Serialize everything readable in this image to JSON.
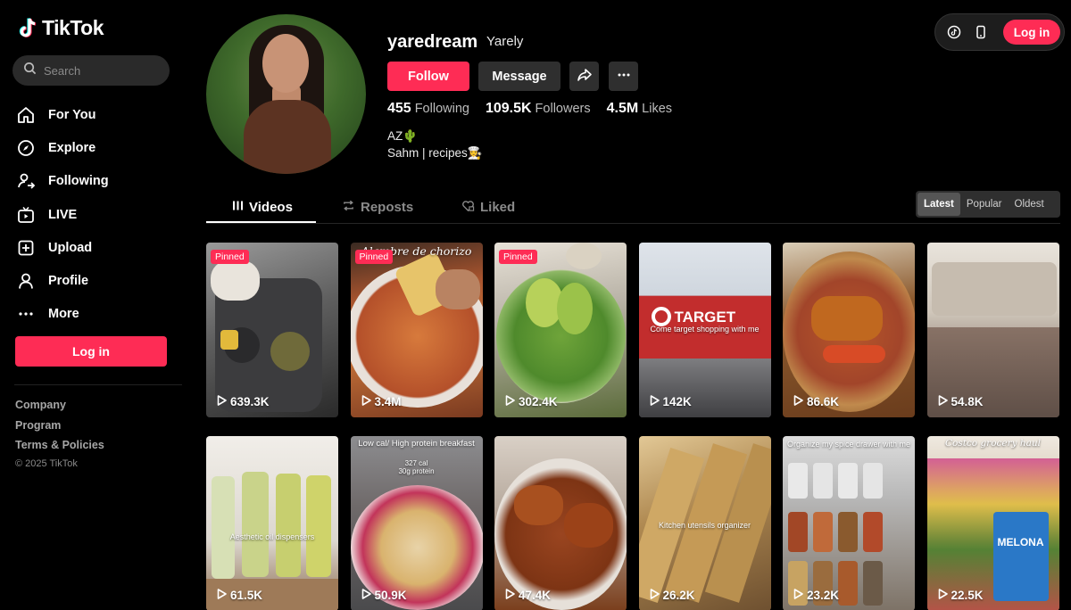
{
  "brand": {
    "name": "TikTok",
    "accent": "#fe2c55"
  },
  "search": {
    "placeholder": "Search"
  },
  "sidebar": {
    "items": [
      {
        "label": "For You",
        "icon": "home-icon"
      },
      {
        "label": "Explore",
        "icon": "compass-icon"
      },
      {
        "label": "Following",
        "icon": "following-icon"
      },
      {
        "label": "LIVE",
        "icon": "live-icon"
      },
      {
        "label": "Upload",
        "icon": "upload-icon"
      },
      {
        "label": "Profile",
        "icon": "profile-icon"
      },
      {
        "label": "More",
        "icon": "more-icon"
      }
    ],
    "login_label": "Log in",
    "footer_links": [
      "Company",
      "Program",
      "Terms & Policies"
    ],
    "copyright": "© 2025 TikTok"
  },
  "topbar": {
    "login_label": "Log in"
  },
  "profile": {
    "username": "yaredream",
    "nickname": "Yarely",
    "follow_label": "Follow",
    "message_label": "Message",
    "stats": {
      "following_count": "455",
      "following_label": "Following",
      "followers_count": "109.5K",
      "followers_label": "Followers",
      "likes_count": "4.5M",
      "likes_label": "Likes"
    },
    "bio_line1": "AZ🌵",
    "bio_line2": "Sahm | recipes👩‍🍳"
  },
  "tabs": {
    "videos": "Videos",
    "reposts": "Reposts",
    "liked": "Liked"
  },
  "sort": {
    "latest": "Latest",
    "popular": "Popular",
    "oldest": "Oldest",
    "selected": "Latest"
  },
  "videos": [
    {
      "views": "639.3K",
      "pinned": "Pinned",
      "caption": ""
    },
    {
      "views": "3.4M",
      "pinned": "Pinned",
      "caption": "Alambre de chorizo"
    },
    {
      "views": "302.4K",
      "pinned": "Pinned",
      "caption": ""
    },
    {
      "views": "142K",
      "pinned": "",
      "caption": "Come target shopping with me"
    },
    {
      "views": "86.6K",
      "pinned": "",
      "caption": ""
    },
    {
      "views": "54.8K",
      "pinned": "",
      "caption": ""
    },
    {
      "views": "61.5K",
      "pinned": "",
      "caption": "Aesthetic oil dispensers"
    },
    {
      "views": "50.9K",
      "pinned": "",
      "caption": "Low cal/ High protein breakfast",
      "caption2": "327 cal",
      "caption3": "30g protein"
    },
    {
      "views": "47.4K",
      "pinned": "",
      "caption": ""
    },
    {
      "views": "26.2K",
      "pinned": "",
      "caption": "Kitchen utensils organizer"
    },
    {
      "views": "23.2K",
      "pinned": "",
      "caption": "Organize my spice drawer with me"
    },
    {
      "views": "22.5K",
      "pinned": "",
      "caption": "Costco grocery haul",
      "caption2": "MELONA"
    }
  ]
}
